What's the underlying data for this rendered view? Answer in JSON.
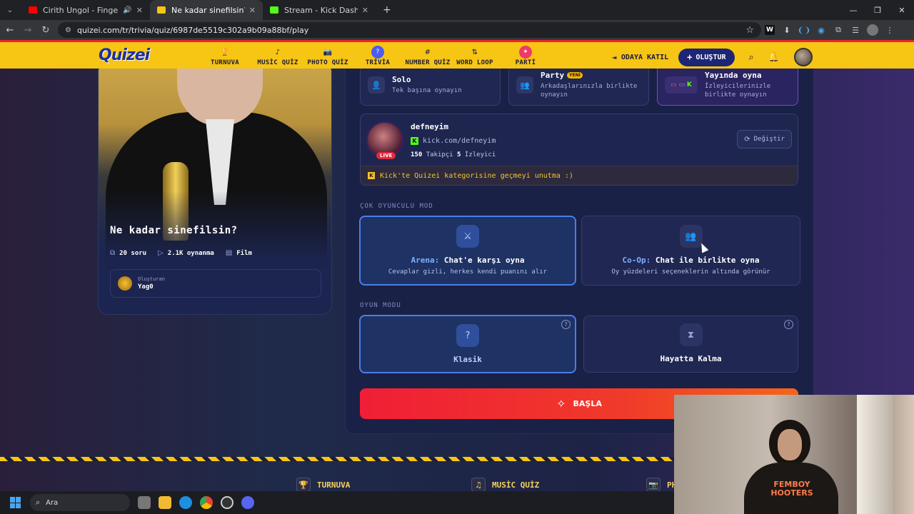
{
  "browser": {
    "tabs": [
      {
        "title": "Cirith Ungol - Finger Of Sc",
        "favicon_color": "#ff0000",
        "active": false,
        "sound_icon": "speaker-icon"
      },
      {
        "title": "Ne kadar sinefilsin? - Quizei",
        "favicon_color": "#f7c514",
        "active": true
      },
      {
        "title": "Stream - Kick Dashboard",
        "favicon_color": "#53fc18",
        "active": false
      }
    ],
    "url": "quizei.com/tr/trivia/quiz/6987de5519c302a9b09a88bf/play"
  },
  "nav": {
    "logo": "Quizei",
    "items": [
      {
        "label": "TURNUVA",
        "icon": "trophy-icon",
        "glyph": "🏆"
      },
      {
        "label": "MUSİC QUİZ",
        "icon": "music-note-icon",
        "glyph": "♪"
      },
      {
        "label": "PHOTO QUİZ",
        "icon": "camera-icon",
        "glyph": "📷"
      },
      {
        "label": "TRİVİA",
        "icon": "question-bubble-icon",
        "glyph": "?"
      },
      {
        "label": "NUMBER QUİZ",
        "icon": "hash-icon",
        "glyph": "#"
      },
      {
        "label": "WORD LOOP",
        "icon": "sort-icon",
        "glyph": "⇅"
      },
      {
        "label": "PARTİ",
        "icon": "party-icon",
        "glyph": "✦"
      }
    ],
    "join_label": "ODAYA KATIL",
    "create_label": "OLUŞTUR"
  },
  "quiz": {
    "title": "Ne kadar sinefilsin?",
    "questions": "20 soru",
    "plays": "2.1K oynanma",
    "category": "Film",
    "creator_label": "Oluşturan",
    "creator_name": "Yag0"
  },
  "play_modes": [
    {
      "title": "Solo",
      "subtitle": "Tek başına oynayın",
      "icon": "user-icon"
    },
    {
      "title": "Party",
      "badge": "YENİ",
      "subtitle": "Arkadaşlarınızla birlikte oynayın",
      "icon": "users-icon"
    },
    {
      "title": "Yayında oyna",
      "subtitle": "İzleyicilerinizle birlikte oynayın",
      "icon": "stream-platforms-icon"
    }
  ],
  "streamer": {
    "name": "defneyim",
    "url": "kick.com/defneyim",
    "followers": "150",
    "followers_label": "Takipçi",
    "viewers": "5",
    "viewers_label": "İzleyici",
    "live_badge": "LIVE",
    "change_label": "Değiştir",
    "note": "Kick'te Quizei kategorisine geçmeyi unutma :)"
  },
  "multiplayer": {
    "section_label": "ÇOK OYUNCULU MOD",
    "arena": {
      "highlight": "Arena:",
      "title": " Chat'e karşı oyna",
      "subtitle": "Cevaplar gizli, herkes kendi puanını alır"
    },
    "coop": {
      "highlight": "Co-Op:",
      "title": " Chat ile birlikte oyna",
      "subtitle": "Oy yüzdeleri seçeneklerin altında görünür"
    }
  },
  "game_mode": {
    "section_label": "OYUN MODU",
    "classic": "Klasik",
    "survival": "Hayatta Kalma"
  },
  "start_label": "BAŞLA",
  "footer": {
    "items": [
      {
        "label": "TURNUVA",
        "icon": "trophy-icon"
      },
      {
        "label": "MUSİC QUİZ",
        "icon": "music-note-icon"
      },
      {
        "label": "PH",
        "icon": "camera-icon"
      }
    ]
  },
  "webcam": {
    "shirt_text": "FEMBOY HOOTERS"
  },
  "taskbar": {
    "search_placeholder": "Ara"
  }
}
